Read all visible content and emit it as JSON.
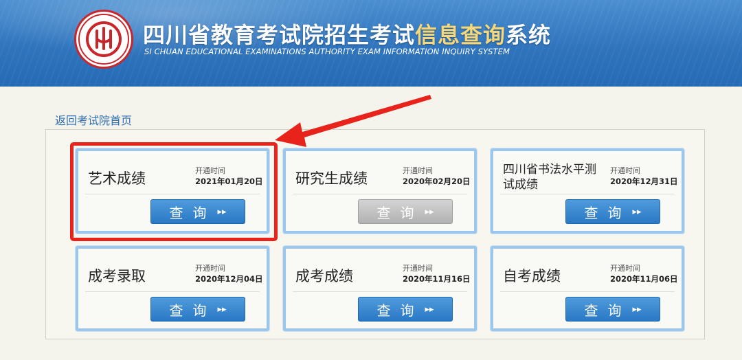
{
  "header": {
    "title_main": "四川省教育考试院招生考试",
    "title_highlight": "信息查询",
    "title_tail": "系统",
    "subtitle_en": "SI CHUAN EDUCATIONAL EXAMINATIONS AUTHORITY EXAM INFORMATION INQUIRY SYSTEM",
    "logo_icon": "sichuan-exam-authority-seal"
  },
  "back_link": "返回考试院首页",
  "cards": [
    {
      "name": "艺术成绩",
      "open_label": "开通时间",
      "open_date": "2021年01月20日",
      "button": "查询",
      "enabled": true
    },
    {
      "name": "研究生成绩",
      "open_label": "开通时间",
      "open_date": "2020年02月20日",
      "button": "查询",
      "enabled": false
    },
    {
      "name": "四川省书法水平测试成绩",
      "open_label": "开通时间",
      "open_date": "2020年12月31日",
      "button": "查询",
      "enabled": true
    },
    {
      "name": "成考录取",
      "open_label": "开通时间",
      "open_date": "2020年12月04日",
      "button": "查询",
      "enabled": true
    },
    {
      "name": "成考成绩",
      "open_label": "开通时间",
      "open_date": "2020年11月16日",
      "button": "查询",
      "enabled": true
    },
    {
      "name": "自考成绩",
      "open_label": "开通时间",
      "open_date": "2020年11月06日",
      "button": "查询",
      "enabled": true
    }
  ],
  "annotation": {
    "highlight_color": "#e8231b",
    "highlighted_card": "艺术成绩"
  },
  "colors": {
    "header_blue": "#2f74bd",
    "button_blue": "#2a78c5",
    "button_disabled": "#b1b1b1",
    "card_border": "#9cc6ec"
  }
}
